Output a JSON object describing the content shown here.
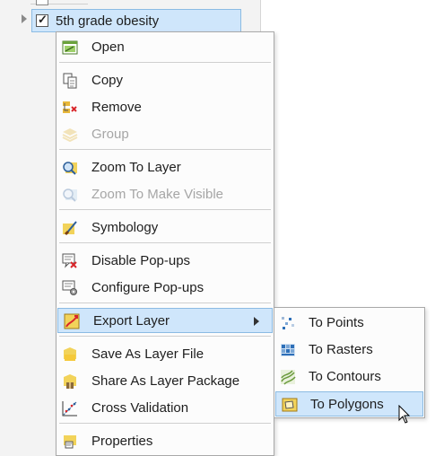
{
  "contents_pane": {
    "layer_name": "5th grade obesity",
    "layer_checked": true
  },
  "context_menu": {
    "items": [
      {
        "label": "Open",
        "icon": "open-attribute-table-icon",
        "enabled": true
      },
      {
        "label": "Copy",
        "icon": "copy-icon",
        "enabled": true
      },
      {
        "label": "Remove",
        "icon": "remove-icon",
        "enabled": true
      },
      {
        "label": "Group",
        "icon": "group-icon",
        "enabled": false
      },
      {
        "label": "Zoom To Layer",
        "icon": "zoom-to-layer-icon",
        "enabled": true
      },
      {
        "label": "Zoom To Make Visible",
        "icon": "zoom-to-make-visible-icon",
        "enabled": false
      },
      {
        "label": "Symbology",
        "icon": "symbology-icon",
        "enabled": true
      },
      {
        "label": "Disable Pop-ups",
        "icon": "disable-popups-icon",
        "enabled": true
      },
      {
        "label": "Configure Pop-ups",
        "icon": "configure-popups-icon",
        "enabled": true
      },
      {
        "label": "Export Layer",
        "icon": "export-layer-icon",
        "enabled": true,
        "highlighted": true,
        "has_submenu": true
      },
      {
        "label": "Save As Layer File",
        "icon": "save-layer-file-icon",
        "enabled": true
      },
      {
        "label": "Share As Layer Package",
        "icon": "share-layer-package-icon",
        "enabled": true
      },
      {
        "label": "Cross Validation",
        "icon": "cross-validation-icon",
        "enabled": true
      },
      {
        "label": "Properties",
        "icon": "properties-icon",
        "enabled": true
      }
    ]
  },
  "export_submenu": {
    "items": [
      {
        "label": "To Points",
        "icon": "to-points-icon"
      },
      {
        "label": "To Rasters",
        "icon": "to-rasters-icon"
      },
      {
        "label": "To Contours",
        "icon": "to-contours-icon"
      },
      {
        "label": "To Polygons",
        "icon": "to-polygons-icon",
        "highlighted": true
      }
    ]
  },
  "colors": {
    "highlight_fill": "#cfe6fb",
    "highlight_border": "#8bbbe3",
    "disabled_text": "#a6a6a6"
  }
}
